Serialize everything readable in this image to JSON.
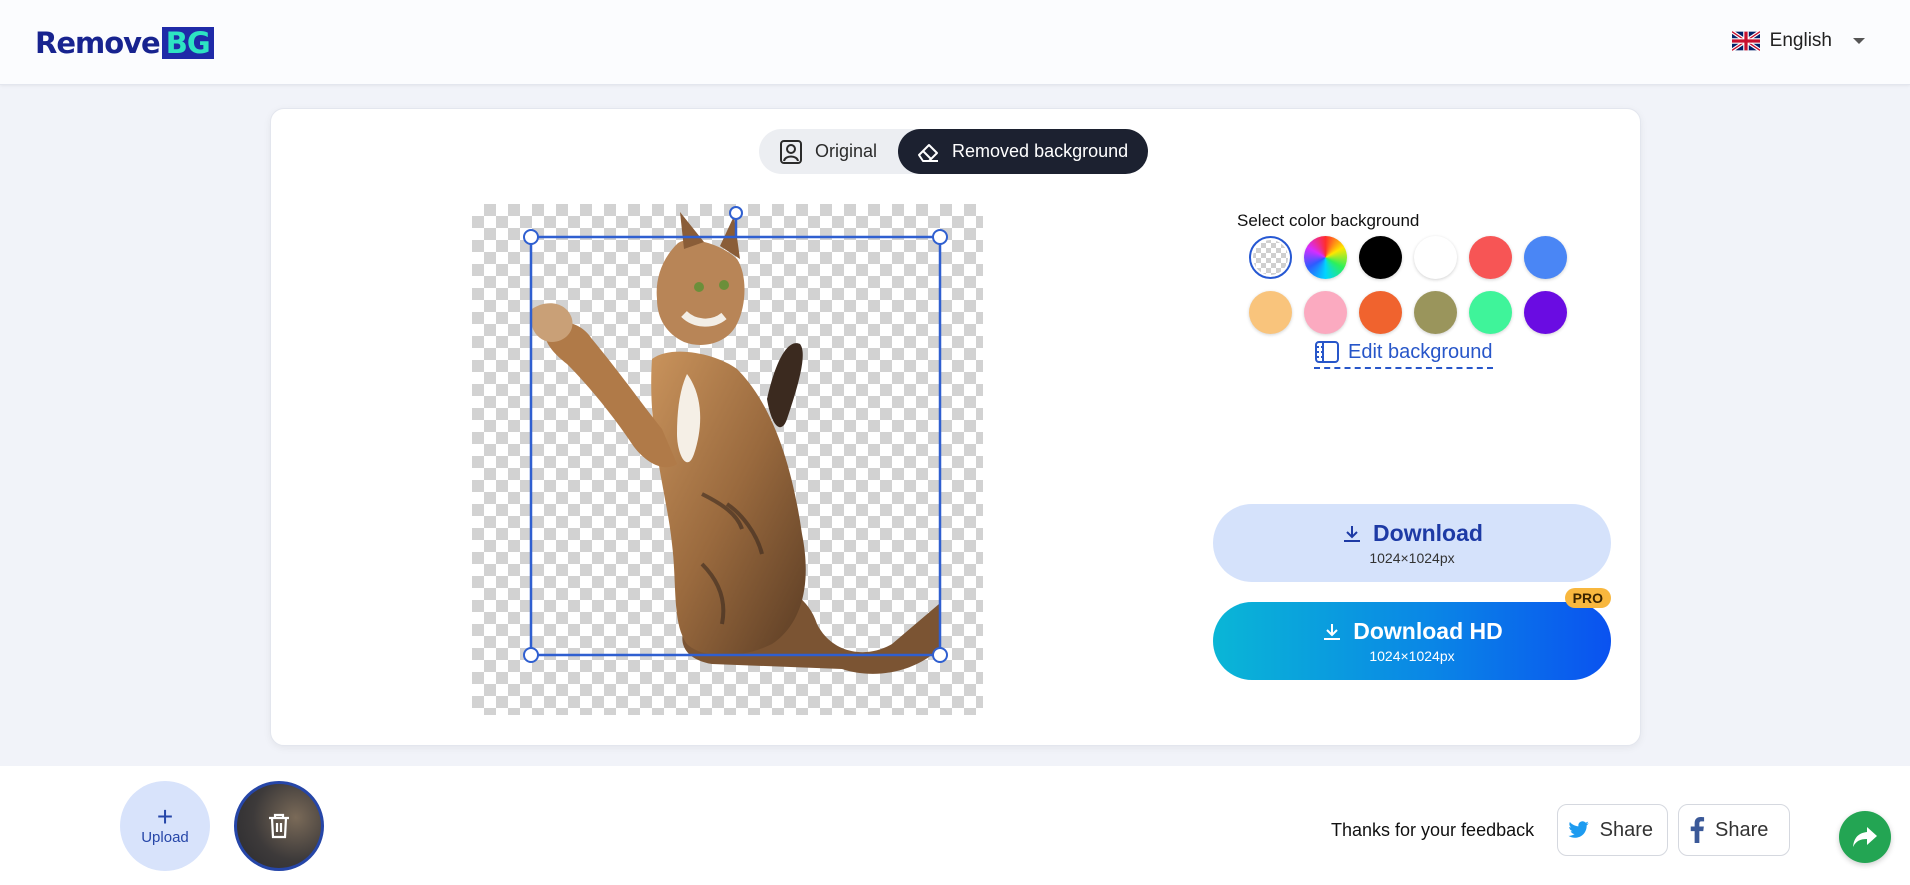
{
  "header": {
    "logo_word": "Remove",
    "logo_badge": "BG",
    "language": "English"
  },
  "view_toggle": {
    "original_label": "Original",
    "removed_label": "Removed background",
    "active": "removed"
  },
  "background_panel": {
    "title": "Select color background",
    "swatches": [
      {
        "name": "transparent",
        "color": "transparent",
        "selected": true
      },
      {
        "name": "rainbow",
        "color": "gradient"
      },
      {
        "name": "black",
        "color": "#000000"
      },
      {
        "name": "white",
        "color": "#ffffff"
      },
      {
        "name": "red",
        "color": "#f75555"
      },
      {
        "name": "blue",
        "color": "#4a86f5"
      },
      {
        "name": "peach",
        "color": "#f9c47c"
      },
      {
        "name": "pink",
        "color": "#fbaac0"
      },
      {
        "name": "orange",
        "color": "#f0632e"
      },
      {
        "name": "olive",
        "color": "#9a955c"
      },
      {
        "name": "mint",
        "color": "#3ff49a"
      },
      {
        "name": "purple",
        "color": "#6a0ce2"
      }
    ],
    "edit_label": "Edit background"
  },
  "downloads": {
    "standard": {
      "label": "Download",
      "size": "1024×1024px"
    },
    "hd": {
      "label": "Download HD",
      "size": "1024×1024px",
      "badge": "PRO"
    }
  },
  "footer": {
    "upload_label": "Upload",
    "feedback_text": "Thanks for your feedback",
    "share_twitter": "Share",
    "share_facebook": "Share"
  },
  "colors": {
    "accent": "#2756c9",
    "brand": "#17238f",
    "toggle_active": "#1c2130",
    "fab": "#23a553"
  }
}
